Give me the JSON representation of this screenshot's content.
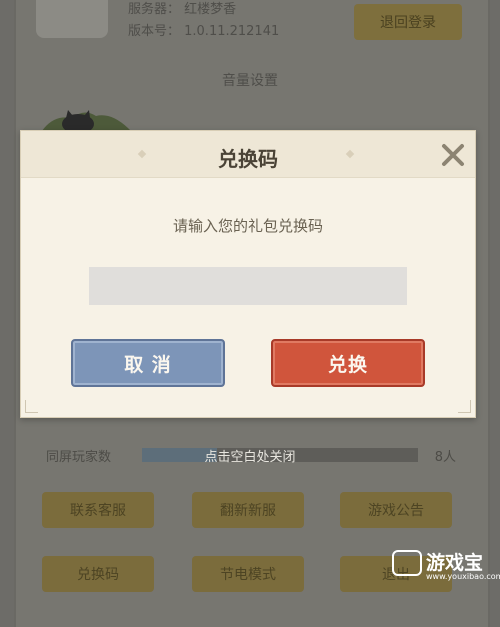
{
  "background": {
    "server_line": "服务器： 红楼梦香",
    "version_line": "版本号： 1.0.11.212141",
    "logout_label": "退回登录",
    "sound_title": "音量设置",
    "same_screen_label": "同屏玩家数",
    "same_screen_count": "8人",
    "same_screen_fill": 0.27,
    "buttons": [
      "联系客服",
      "翻新新服",
      "游戏公告",
      "兑换码",
      "节电模式",
      "退出"
    ]
  },
  "dialog": {
    "title": "兑换码",
    "prompt": "请输入您的礼包兑换码",
    "input_value": "",
    "cancel_label": "取 消",
    "confirm_label": "兑换"
  },
  "hint": "点击空白处关闭",
  "watermark": {
    "name": "游戏宝",
    "url": "www.youxibao.com"
  },
  "colors": {
    "cancel": "#7d95b8",
    "confirm": "#d0553c",
    "overlay": "#6d6c68"
  }
}
